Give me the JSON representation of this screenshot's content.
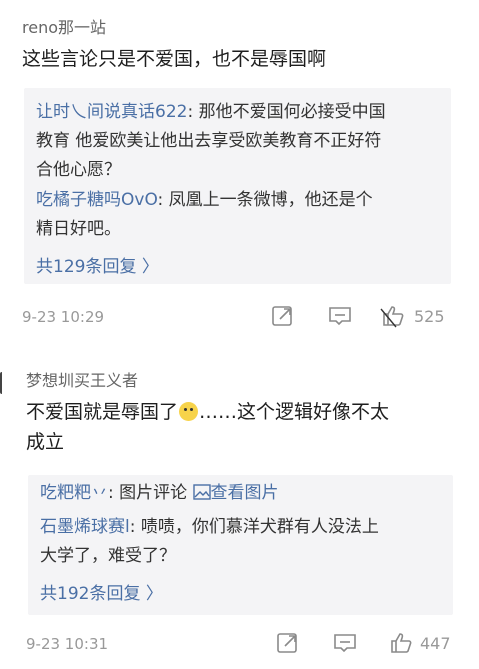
{
  "comments": [
    {
      "username": "reno那一站",
      "text": "这些言论只是不爱国，也不是辱国啊",
      "replies": [
        {
          "user": "让时乀间说真话622",
          "sep": ": ",
          "line1": "那他不爱国何必接受中国",
          "line2": "教育 他爱欧美让他出去享受欧美教育不正好符",
          "line3": "合他心愿？"
        },
        {
          "user": "吃橘子糖吗OvO",
          "sep": ": ",
          "line1": "凤凰上一条微博，他还是个",
          "line2": "精日好吧。"
        }
      ],
      "more_replies": "共129条回复 〉",
      "time": "9-23 10:29",
      "likes": "525"
    },
    {
      "username": "梦想圳买王义者",
      "text_part1": "不爱国就是辱国了",
      "text_part2": "……这个逻辑好像不太",
      "text_line2": "成立",
      "replies": [
        {
          "user": "吃粑粑丷",
          "sep": ": ",
          "line1": "图片评论",
          "pic_link": "查看图片"
        },
        {
          "user": "石墨烯球赛l",
          "sep": ": ",
          "line1": "啧啧，你们慕洋犬群有人没法上",
          "line2": "大学了，难受了？"
        }
      ],
      "more_replies": "共192条回复 〉",
      "time": "9-23 10:31",
      "likes": "447"
    }
  ],
  "icons": {
    "forward": "forward-icon",
    "comment": "comment-icon",
    "like": "like-icon"
  },
  "colors": {
    "link": "#4a6fa5",
    "reply_bg": "#f4f4f6",
    "muted": "#999999"
  }
}
